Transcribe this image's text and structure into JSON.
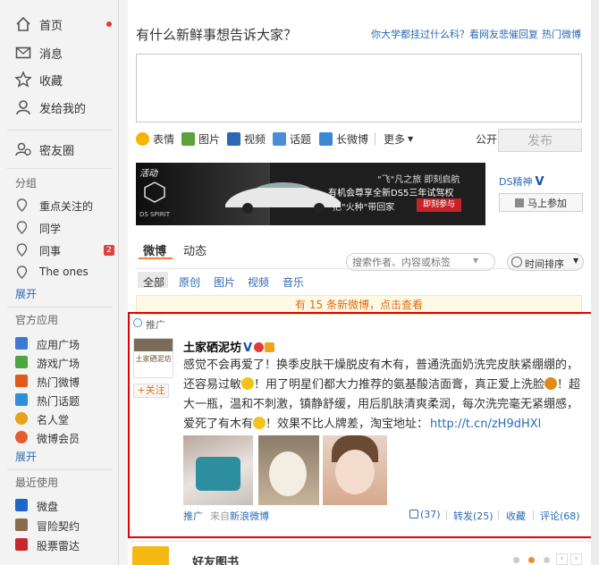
{
  "sidebar": {
    "nav": [
      {
        "label": "首页",
        "icon": "home-icon"
      },
      {
        "label": "消息",
        "icon": "mail-icon"
      },
      {
        "label": "收藏",
        "icon": "star-icon"
      },
      {
        "label": "发给我的",
        "icon": "user-icon"
      }
    ],
    "close_friends": "密友圈",
    "group_title": "分组",
    "groups": [
      {
        "label": "重点关注的"
      },
      {
        "label": "同学"
      },
      {
        "label": "同事",
        "badge": "2"
      },
      {
        "label": "The ones"
      }
    ],
    "expand1": "展开",
    "official_title": "官方应用",
    "official_apps": [
      {
        "label": "应用广场",
        "color": "#3b7bd1"
      },
      {
        "label": "游戏广场",
        "color": "#4aa83c"
      },
      {
        "label": "热门微博",
        "color": "#e2591b"
      },
      {
        "label": "热门话题",
        "color": "#2d8fd5"
      },
      {
        "label": "名人堂",
        "color": "#e8a317"
      },
      {
        "label": "微博会员",
        "color": "#e55f2e"
      }
    ],
    "expand2": "展开",
    "recent_title": "最近使用",
    "recent_apps": [
      {
        "label": "微盘",
        "color": "#1f66c6"
      },
      {
        "label": "冒险契约",
        "color": "#8a6e4b"
      },
      {
        "label": "股票雷达",
        "color": "#c8282d"
      }
    ]
  },
  "composer": {
    "prompt": "有什么新鲜事想告诉大家？",
    "topic_link": "你大学都挂过什么科？看网友悲催回复",
    "hot_link": "热门微博",
    "tools": [
      {
        "label": "表情",
        "color": "#f5b400"
      },
      {
        "label": "图片",
        "color": "#5ea13a"
      },
      {
        "label": "视频",
        "color": "#2e67b2"
      },
      {
        "label": "话题",
        "color": "#4a8fd6"
      },
      {
        "label": "长微博",
        "color": "#3d86d1"
      }
    ],
    "more": "更多",
    "visibility": "公开",
    "publish": "发布"
  },
  "ad": {
    "tag": "活动",
    "line1": "\"飞\"凡之旅 即刻启航",
    "line2": "有机会尊享全新DS5三年试驾权",
    "line3": "把\"火种\"带回家",
    "cta": "即刻参与",
    "logo": "DS SPIRIT",
    "account": "DS精神",
    "join_button": "马上参加"
  },
  "feed": {
    "tabs": [
      "微博",
      "动态"
    ],
    "search_placeholder": "搜索作者、内容或标签",
    "sort": "时间排序",
    "filters": [
      "全部",
      "原创",
      "图片",
      "视频",
      "音乐"
    ],
    "new_notice": "有 15 条新微博，点击查看"
  },
  "post": {
    "promo_label": "推广",
    "author": "土家硒泥坊",
    "follow": "+关注",
    "avatar_text": "土家硒泥坊",
    "text_a": "感觉不会再爱了！换季皮肤干燥脱皮有木有，普通洗面奶洗完皮肤紧绷绷的，还容易过敏",
    "text_b": "！用了明星们都大力推荐的氨基酸洁面膏，真正爱上洗脸",
    "text_c": "！超大一瓶，温和不刺激，镇静舒缓，用后肌肤清爽柔润，每次洗完毫无紧绷感，爱死了有木有",
    "text_d": "！效果不比人牌差，淘宝地址：",
    "url": "http://t.cn/zH9dHXl",
    "source_prefix": "推广",
    "source_from": "来自",
    "source_app": "新浪微博",
    "likes": "(37)",
    "repost": "转发(25)",
    "favorite": "收藏",
    "comment": "评论(68)"
  },
  "next_card": {
    "title": "好友图书"
  }
}
